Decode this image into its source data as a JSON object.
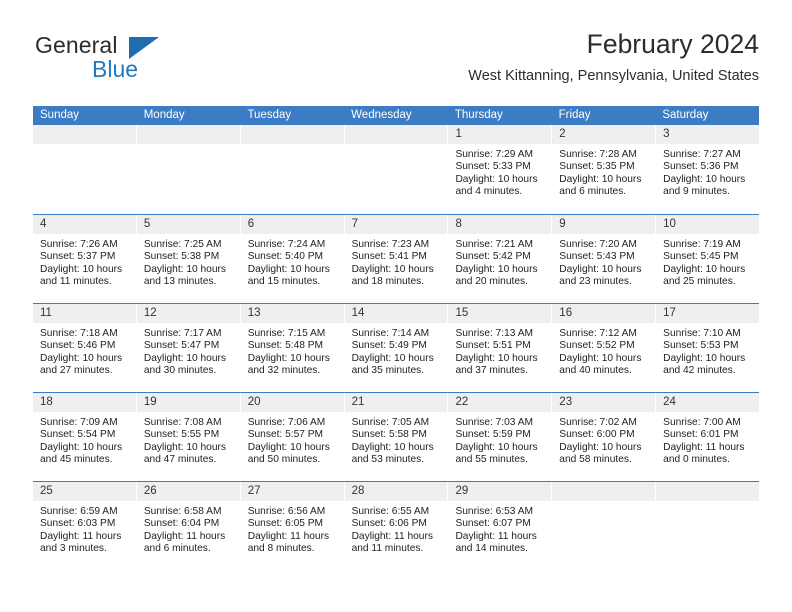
{
  "brand": {
    "name_top": "General",
    "name_bottom": "Blue",
    "triangle_icon": "blue-triangle-icon",
    "color_text": "#2b2b2b",
    "color_blue": "#1f7ac4"
  },
  "header": {
    "title": "February 2024",
    "subtitle": "West Kittanning, Pennsylvania, United States"
  },
  "colors": {
    "header_blue": "#3b7cc4",
    "daynum_gray": "#efefef",
    "text": "#1f1f1f"
  },
  "weekdays": [
    "Sunday",
    "Monday",
    "Tuesday",
    "Wednesday",
    "Thursday",
    "Friday",
    "Saturday"
  ],
  "labels": {
    "sunrise": "Sunrise:",
    "sunset": "Sunset:",
    "daylight": "Daylight:"
  },
  "weeks": [
    [
      {
        "day": "",
        "sunrise": "",
        "sunset": "",
        "daylight": ""
      },
      {
        "day": "",
        "sunrise": "",
        "sunset": "",
        "daylight": ""
      },
      {
        "day": "",
        "sunrise": "",
        "sunset": "",
        "daylight": ""
      },
      {
        "day": "",
        "sunrise": "",
        "sunset": "",
        "daylight": ""
      },
      {
        "day": "1",
        "sunrise": "Sunrise: 7:29 AM",
        "sunset": "Sunset: 5:33 PM",
        "daylight": "Daylight: 10 hours and 4 minutes."
      },
      {
        "day": "2",
        "sunrise": "Sunrise: 7:28 AM",
        "sunset": "Sunset: 5:35 PM",
        "daylight": "Daylight: 10 hours and 6 minutes."
      },
      {
        "day": "3",
        "sunrise": "Sunrise: 7:27 AM",
        "sunset": "Sunset: 5:36 PM",
        "daylight": "Daylight: 10 hours and 9 minutes."
      }
    ],
    [
      {
        "day": "4",
        "sunrise": "Sunrise: 7:26 AM",
        "sunset": "Sunset: 5:37 PM",
        "daylight": "Daylight: 10 hours and 11 minutes."
      },
      {
        "day": "5",
        "sunrise": "Sunrise: 7:25 AM",
        "sunset": "Sunset: 5:38 PM",
        "daylight": "Daylight: 10 hours and 13 minutes."
      },
      {
        "day": "6",
        "sunrise": "Sunrise: 7:24 AM",
        "sunset": "Sunset: 5:40 PM",
        "daylight": "Daylight: 10 hours and 15 minutes."
      },
      {
        "day": "7",
        "sunrise": "Sunrise: 7:23 AM",
        "sunset": "Sunset: 5:41 PM",
        "daylight": "Daylight: 10 hours and 18 minutes."
      },
      {
        "day": "8",
        "sunrise": "Sunrise: 7:21 AM",
        "sunset": "Sunset: 5:42 PM",
        "daylight": "Daylight: 10 hours and 20 minutes."
      },
      {
        "day": "9",
        "sunrise": "Sunrise: 7:20 AM",
        "sunset": "Sunset: 5:43 PM",
        "daylight": "Daylight: 10 hours and 23 minutes."
      },
      {
        "day": "10",
        "sunrise": "Sunrise: 7:19 AM",
        "sunset": "Sunset: 5:45 PM",
        "daylight": "Daylight: 10 hours and 25 minutes."
      }
    ],
    [
      {
        "day": "11",
        "sunrise": "Sunrise: 7:18 AM",
        "sunset": "Sunset: 5:46 PM",
        "daylight": "Daylight: 10 hours and 27 minutes."
      },
      {
        "day": "12",
        "sunrise": "Sunrise: 7:17 AM",
        "sunset": "Sunset: 5:47 PM",
        "daylight": "Daylight: 10 hours and 30 minutes."
      },
      {
        "day": "13",
        "sunrise": "Sunrise: 7:15 AM",
        "sunset": "Sunset: 5:48 PM",
        "daylight": "Daylight: 10 hours and 32 minutes."
      },
      {
        "day": "14",
        "sunrise": "Sunrise: 7:14 AM",
        "sunset": "Sunset: 5:49 PM",
        "daylight": "Daylight: 10 hours and 35 minutes."
      },
      {
        "day": "15",
        "sunrise": "Sunrise: 7:13 AM",
        "sunset": "Sunset: 5:51 PM",
        "daylight": "Daylight: 10 hours and 37 minutes."
      },
      {
        "day": "16",
        "sunrise": "Sunrise: 7:12 AM",
        "sunset": "Sunset: 5:52 PM",
        "daylight": "Daylight: 10 hours and 40 minutes."
      },
      {
        "day": "17",
        "sunrise": "Sunrise: 7:10 AM",
        "sunset": "Sunset: 5:53 PM",
        "daylight": "Daylight: 10 hours and 42 minutes."
      }
    ],
    [
      {
        "day": "18",
        "sunrise": "Sunrise: 7:09 AM",
        "sunset": "Sunset: 5:54 PM",
        "daylight": "Daylight: 10 hours and 45 minutes."
      },
      {
        "day": "19",
        "sunrise": "Sunrise: 7:08 AM",
        "sunset": "Sunset: 5:55 PM",
        "daylight": "Daylight: 10 hours and 47 minutes."
      },
      {
        "day": "20",
        "sunrise": "Sunrise: 7:06 AM",
        "sunset": "Sunset: 5:57 PM",
        "daylight": "Daylight: 10 hours and 50 minutes."
      },
      {
        "day": "21",
        "sunrise": "Sunrise: 7:05 AM",
        "sunset": "Sunset: 5:58 PM",
        "daylight": "Daylight: 10 hours and 53 minutes."
      },
      {
        "day": "22",
        "sunrise": "Sunrise: 7:03 AM",
        "sunset": "Sunset: 5:59 PM",
        "daylight": "Daylight: 10 hours and 55 minutes."
      },
      {
        "day": "23",
        "sunrise": "Sunrise: 7:02 AM",
        "sunset": "Sunset: 6:00 PM",
        "daylight": "Daylight: 10 hours and 58 minutes."
      },
      {
        "day": "24",
        "sunrise": "Sunrise: 7:00 AM",
        "sunset": "Sunset: 6:01 PM",
        "daylight": "Daylight: 11 hours and 0 minutes."
      }
    ],
    [
      {
        "day": "25",
        "sunrise": "Sunrise: 6:59 AM",
        "sunset": "Sunset: 6:03 PM",
        "daylight": "Daylight: 11 hours and 3 minutes."
      },
      {
        "day": "26",
        "sunrise": "Sunrise: 6:58 AM",
        "sunset": "Sunset: 6:04 PM",
        "daylight": "Daylight: 11 hours and 6 minutes."
      },
      {
        "day": "27",
        "sunrise": "Sunrise: 6:56 AM",
        "sunset": "Sunset: 6:05 PM",
        "daylight": "Daylight: 11 hours and 8 minutes."
      },
      {
        "day": "28",
        "sunrise": "Sunrise: 6:55 AM",
        "sunset": "Sunset: 6:06 PM",
        "daylight": "Daylight: 11 hours and 11 minutes."
      },
      {
        "day": "29",
        "sunrise": "Sunrise: 6:53 AM",
        "sunset": "Sunset: 6:07 PM",
        "daylight": "Daylight: 11 hours and 14 minutes."
      },
      {
        "day": "",
        "sunrise": "",
        "sunset": "",
        "daylight": ""
      },
      {
        "day": "",
        "sunrise": "",
        "sunset": "",
        "daylight": ""
      }
    ]
  ]
}
